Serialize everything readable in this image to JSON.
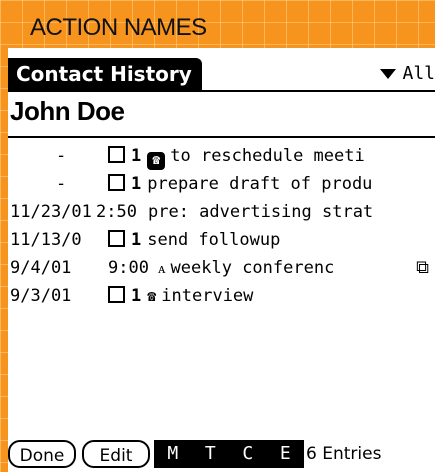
{
  "section_title": "ACTION NAMES",
  "header": {
    "title": "Contact History",
    "category": "All"
  },
  "contact": {
    "name": "John Doe"
  },
  "rows": [
    {
      "date": "-",
      "time": "",
      "checkbox": true,
      "priority": "1",
      "icon": "phone-badge-icon",
      "text": "to reschedule meeti",
      "note": false
    },
    {
      "date": "-",
      "time": "",
      "checkbox": true,
      "priority": "1",
      "icon": "",
      "text": "prepare draft of produ",
      "note": false
    },
    {
      "date": "11/23/01",
      "time": "2:50",
      "checkbox": false,
      "priority": "",
      "icon": "",
      "text": "pre: advertising strat",
      "note": false
    },
    {
      "date": "11/13/0",
      "time": "",
      "checkbox": true,
      "priority": "1",
      "icon": "",
      "text": "send followup",
      "note": false
    },
    {
      "date": "9/4/01",
      "time": "9:00",
      "checkbox": false,
      "priority": "",
      "icon": "",
      "text": "weekly conferenc",
      "note": true
    },
    {
      "date": "9/3/01",
      "time": "",
      "checkbox": true,
      "priority": "1",
      "icon": "telephone-icon",
      "text": "interview",
      "note": false
    }
  ],
  "toolbar": {
    "done_label": "Done",
    "edit_label": "Edit",
    "filters": [
      "M",
      "T",
      "C",
      "E"
    ],
    "entries": "6 Entries"
  }
}
